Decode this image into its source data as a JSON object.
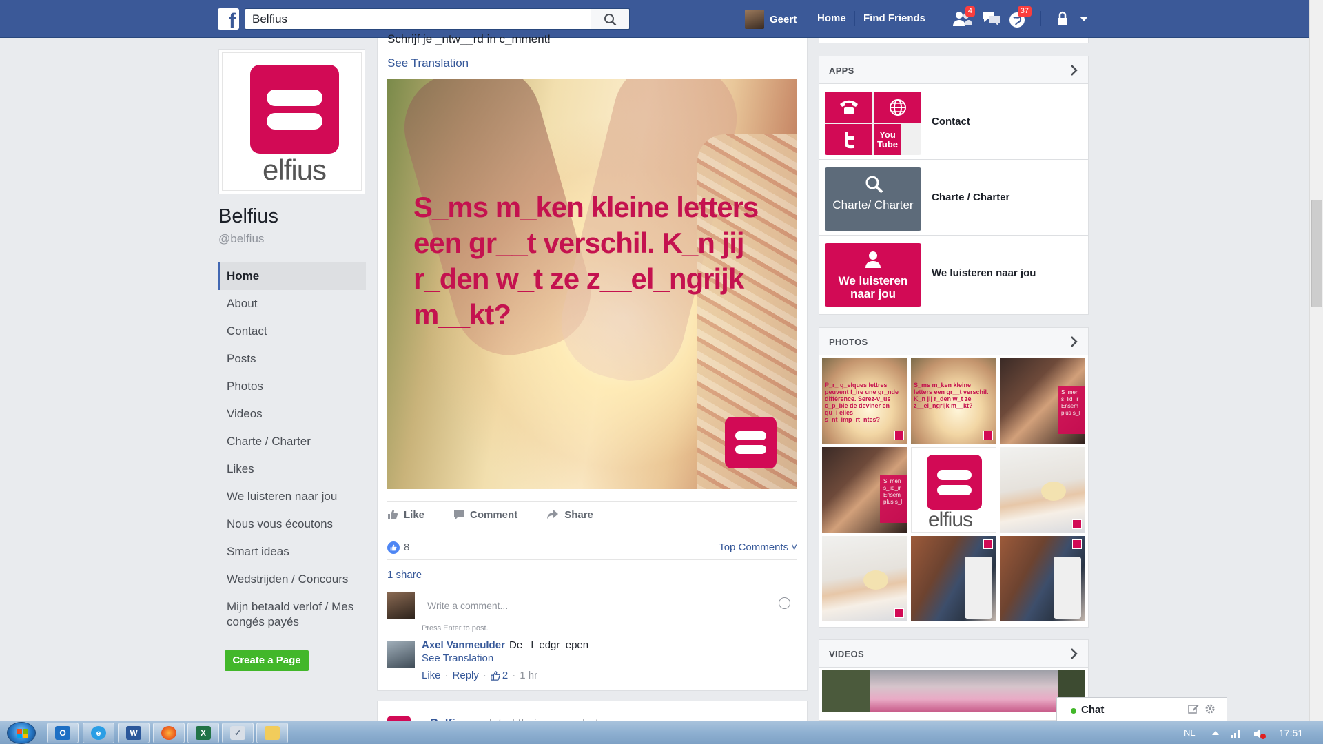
{
  "topbar": {
    "logo": "f",
    "search_value": "Belfius",
    "user_name": "Geert",
    "home_label": "Home",
    "find_friends_label": "Find Friends",
    "friend_requests_count": "4",
    "notifications_count": "37"
  },
  "page": {
    "logo_word": "elfius",
    "name": "Belfius",
    "handle": "@belfius",
    "nav": [
      "Home",
      "About",
      "Contact",
      "Posts",
      "Photos",
      "Videos",
      "Charte / Charter",
      "Likes",
      "We luisteren naar jou",
      "Nous vous écoutons",
      "Smart ideas",
      "Wedstrijden / Concours",
      "Mijn betaald verlof / Mes congés payés"
    ],
    "create_page_label": "Create a Page"
  },
  "post": {
    "snippet": "Schrijf je _ntw__rd in c_mment!",
    "see_translation": "See Translation",
    "image_text": "S_ms m_ken kleine letters een gr__t verschil. K_n jij r_den w_t ze z__el_ngrijk m__kt?",
    "actions": {
      "like": "Like",
      "comment": "Comment",
      "share": "Share"
    },
    "likes_count": "8",
    "top_comments": "Top Comments ˅",
    "shares": "1 share",
    "comment_placeholder": "Write a comment...",
    "press_enter": "Press Enter to post.",
    "comment": {
      "author": "Axel Vanmeulder",
      "text": "De _l_edgr_epen",
      "see_translation": "See Translation",
      "like": "Like",
      "reply": "Reply",
      "like_count": "2",
      "time": "1 hr"
    }
  },
  "next_post": {
    "author": "Belfius",
    "action": "updated their cover photo."
  },
  "right": {
    "apps_title": "APPS",
    "apps": [
      {
        "label": "Contact",
        "tile_youtube": "You Tube"
      },
      {
        "label": "Charte / Charter",
        "tile_text": "Charte/ Charter"
      },
      {
        "label": "We luisteren naar jou",
        "tile_text": "We luisteren naar jou"
      }
    ],
    "photos_title": "PHOTOS",
    "photo_texts": {
      "p1": "P_r_ q_elques lettres peuvent f_ire une gr_nde différence. Serez-v_us c_p_ble de deviner en qu_i elles s_nt_imp_rt_ntes?",
      "p2": "S_ms m_ken kleine letters een gr__t verschil. K_n jij r_den w_t ze z__el_ngrijk m__kt?",
      "heart": "S_men s_lid_ir Ensem plus s_l",
      "logo_word": "elfius"
    },
    "videos_title": "VIDEOS"
  },
  "chat": {
    "label": "Chat"
  },
  "taskbar": {
    "lang": "NL",
    "clock": "17:51"
  },
  "colors": {
    "facebook_blue": "#3b5998",
    "belfius_red": "#d20a55",
    "link_blue": "#365899",
    "create_green": "#42b72a"
  }
}
